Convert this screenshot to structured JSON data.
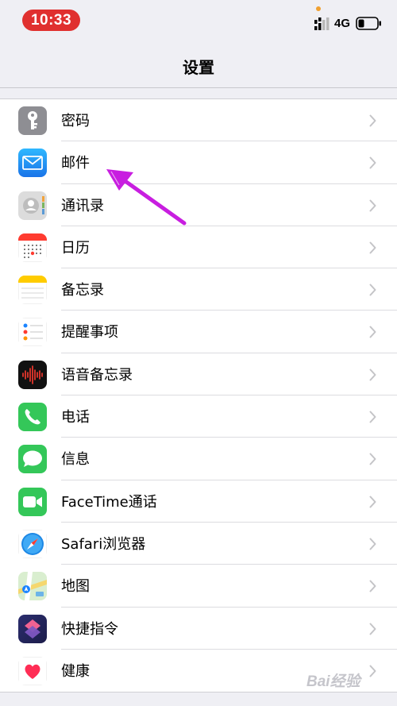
{
  "status_bar": {
    "time": "10:33",
    "network": "4G"
  },
  "nav": {
    "title": "设置"
  },
  "settings": [
    {
      "label": "密码",
      "icon": "key-icon"
    },
    {
      "label": "邮件",
      "icon": "mail-icon"
    },
    {
      "label": "通讯录",
      "icon": "contacts-icon"
    },
    {
      "label": "日历",
      "icon": "calendar-icon"
    },
    {
      "label": "备忘录",
      "icon": "notes-icon"
    },
    {
      "label": "提醒事项",
      "icon": "reminders-icon"
    },
    {
      "label": "语音备忘录",
      "icon": "voice-memos-icon"
    },
    {
      "label": "电话",
      "icon": "phone-icon"
    },
    {
      "label": "信息",
      "icon": "messages-icon"
    },
    {
      "label": "FaceTime通话",
      "icon": "facetime-icon"
    },
    {
      "label": "Safari浏览器",
      "icon": "safari-icon"
    },
    {
      "label": "地图",
      "icon": "maps-icon"
    },
    {
      "label": "快捷指令",
      "icon": "shortcuts-icon"
    },
    {
      "label": "健康",
      "icon": "health-icon"
    }
  ],
  "watermark": {
    "text": "Bai经验"
  },
  "colors": {
    "time_pill": "#e0302f",
    "annotation_arrow": "#c81ee0",
    "background": "#efeff4"
  }
}
